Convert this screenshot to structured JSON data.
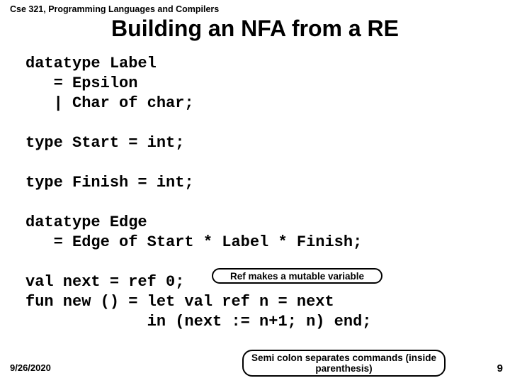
{
  "header": "Cse 321, Programming Languages and Compilers",
  "title": "Building an NFA from a RE",
  "code": "datatype Label\n   = Epsilon\n   | Char of char;\n\ntype Start = int;\n\ntype Finish = int;\n\ndatatype Edge\n   = Edge of Start * Label * Finish;\n\nval next = ref 0;\nfun new () = let val ref n = next\n             in (next := n+1; n) end;",
  "callout1": "Ref makes a mutable variable",
  "callout2": "Semi colon separates commands (inside parenthesis)",
  "date": "9/26/2020",
  "pagenum": "9"
}
